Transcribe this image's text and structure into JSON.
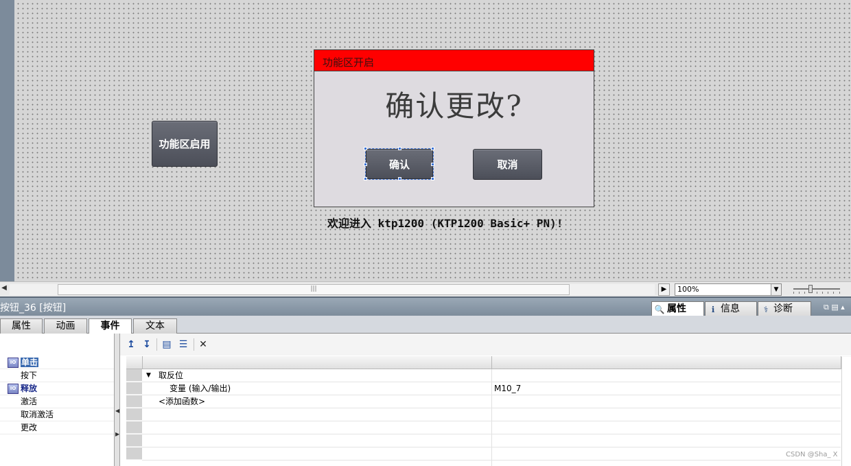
{
  "canvas": {
    "function_enable_button": "功能区启用",
    "dialog": {
      "title": "功能区开启",
      "question": "确认更改?",
      "confirm_label": "确认",
      "cancel_label": "取消"
    },
    "welcome_text": "欢迎进入 ktp1200 (KTP1200 Basic+ PN)!"
  },
  "scrollbar": {
    "zoom": "100%"
  },
  "inspector": {
    "object_title": "按钮_36 [按钮]",
    "tabs": [
      {
        "label": "属性",
        "icon": "properties-icon",
        "active": true
      },
      {
        "label": "信息",
        "icon": "info-icon",
        "active": false
      },
      {
        "label": "诊断",
        "icon": "diagnostics-icon",
        "active": false
      }
    ],
    "sub_tabs": [
      {
        "label": "属性"
      },
      {
        "label": "动画"
      },
      {
        "label": "事件",
        "active": true
      },
      {
        "label": "文本"
      }
    ],
    "events": [
      {
        "label": "单击",
        "icon": "event-icon",
        "bold": true,
        "selected": true
      },
      {
        "label": "按下"
      },
      {
        "label": "释放",
        "icon": "event-icon",
        "bold": true
      },
      {
        "label": "激活"
      },
      {
        "label": "取消激活"
      },
      {
        "label": "更改"
      }
    ],
    "toolbar": [
      "move-up-icon",
      "move-down-icon",
      "folder-icon",
      "list-icon",
      "delete-icon"
    ],
    "function_list": {
      "function_name": "取反位",
      "param_label": "变量 (输入/输出)",
      "param_value": "M10_7",
      "add_function": "<添加函数>"
    }
  },
  "watermark": "CSDN @Sha_ X"
}
